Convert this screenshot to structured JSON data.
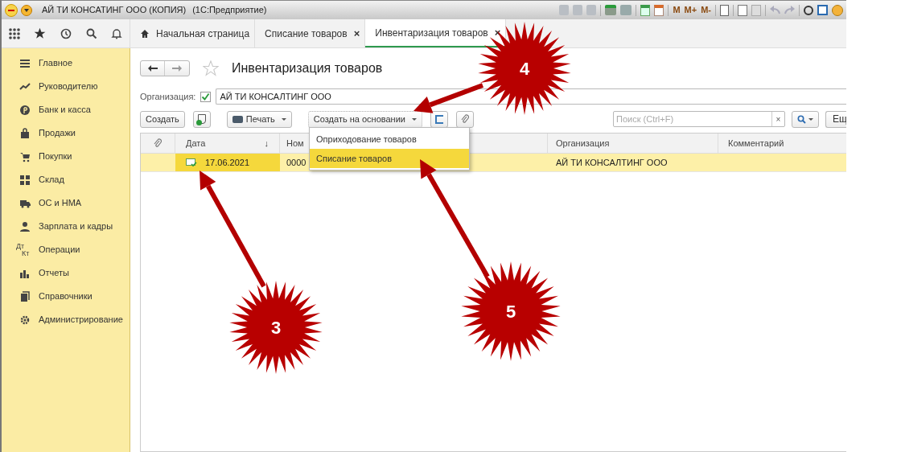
{
  "window": {
    "title": "АЙ ТИ КОНСАТИНГ ООО (КОПИЯ)",
    "subtitle": "(1С:Предприятие)",
    "memory_buttons": [
      "M",
      "M+",
      "M-"
    ]
  },
  "tabs": [
    {
      "label": "Начальная страница",
      "kind": "home",
      "selected": false
    },
    {
      "label": "Списание товаров",
      "kind": "closable",
      "close": "×",
      "selected": false
    },
    {
      "label": "Инвентаризация товаров",
      "kind": "closable",
      "close": "×",
      "selected": true
    }
  ],
  "sidebar": {
    "items": [
      {
        "label": "Главное"
      },
      {
        "label": "Руководителю"
      },
      {
        "label": "Банк и касса"
      },
      {
        "label": "Продажи"
      },
      {
        "label": "Покупки"
      },
      {
        "label": "Склад"
      },
      {
        "label": "ОС и НМА"
      },
      {
        "label": "Зарплата и кадры"
      },
      {
        "label": "Операции",
        "icon_text": [
          "Дт",
          "Кт"
        ]
      },
      {
        "label": "Отчеты"
      },
      {
        "label": "Справочники"
      },
      {
        "label": "Администрирование"
      }
    ]
  },
  "form": {
    "title": "Инвентаризация товаров",
    "organization": {
      "label": "Организация:",
      "checked": true,
      "value": "АЙ ТИ КОНСАЛТИНГ ООО"
    },
    "toolbar": {
      "create": "Создать",
      "print": "Печать",
      "create_based": "Создать на основании",
      "search_placeholder": "Поиск (Ctrl+F)",
      "clear": "×",
      "more": "Ещ"
    },
    "menu": [
      {
        "label": "Оприходование товаров",
        "selected": false
      },
      {
        "label": "Списание товаров",
        "selected": true
      }
    ]
  },
  "table": {
    "columns": [
      "Дата",
      "Ном",
      "Организация",
      "Комментарий"
    ],
    "sort_mark": "↓",
    "rows": [
      {
        "date": "17.06.2021",
        "number": "0000",
        "organization": "АЙ ТИ КОНСАЛТИНГ ООО",
        "selected": true
      }
    ]
  },
  "annotations": [
    {
      "number": "3"
    },
    {
      "number": "4"
    },
    {
      "number": "5"
    }
  ]
}
